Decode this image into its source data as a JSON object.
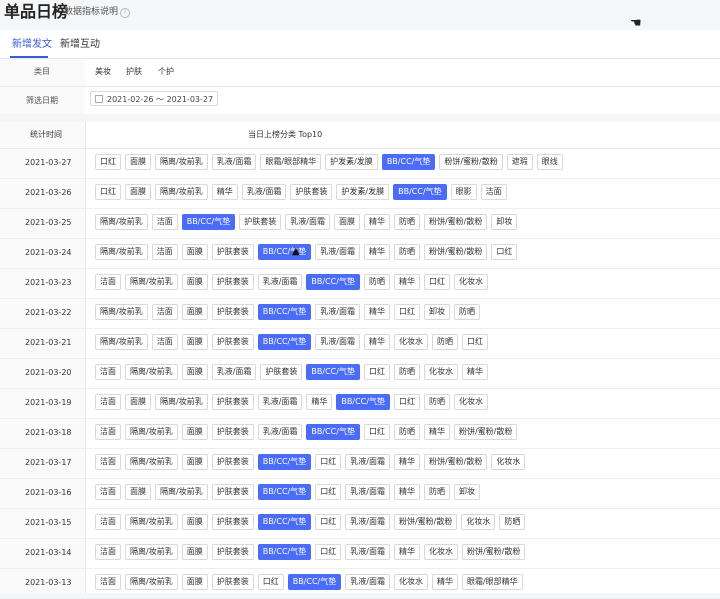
{
  "header": {
    "title": "单品日榜",
    "data_desc": "数据指标说明",
    "help_icon": "question-circle-icon",
    "cursor_icon": "hand-cursor-icon"
  },
  "tabs": [
    {
      "label": "新增发文",
      "active": true
    },
    {
      "label": "新增互动",
      "active": false
    }
  ],
  "filters": {
    "category_label": "类目",
    "categories": [
      "美妆",
      "护肤",
      "个护"
    ],
    "date_label": "筛选日期",
    "date_start": "2021-02-26",
    "date_sep": "～",
    "date_end": "2021-03-27",
    "calendar_icon": "calendar-icon"
  },
  "table": {
    "col_time": "统计时间",
    "col_top": "当日上榜分类 Top10",
    "highlight_color": "#4a6cf7",
    "highlight_tag": "BB/CC/气垫",
    "rows": [
      {
        "date": "2021-03-27",
        "tags": [
          "口红",
          "面膜",
          "隔离/妆前乳",
          "乳液/面霜",
          "眼霜/眼部精华",
          "护发素/发膜",
          "BB/CC/气垫",
          "粉饼/蜜粉/散粉",
          "遮瑕",
          "眼线"
        ]
      },
      {
        "date": "2021-03-26",
        "tags": [
          "口红",
          "面膜",
          "隔离/妆前乳",
          "精华",
          "乳液/面霜",
          "护肤套装",
          "护发素/发膜",
          "BB/CC/气垫",
          "眼影",
          "洁面"
        ]
      },
      {
        "date": "2021-03-25",
        "tags": [
          "隔离/妆前乳",
          "洁面",
          "BB/CC/气垫",
          "护肤套装",
          "乳液/面霜",
          "面膜",
          "精华",
          "防晒",
          "粉饼/蜜粉/散粉",
          "卸妆"
        ]
      },
      {
        "date": "2021-03-24",
        "tags": [
          "隔离/妆前乳",
          "洁面",
          "面膜",
          "护肤套装",
          "BB/CC/气垫",
          "乳液/面霜",
          "精华",
          "防晒",
          "粉饼/蜜粉/散粉",
          "口红"
        ]
      },
      {
        "date": "2021-03-23",
        "tags": [
          "洁面",
          "隔离/妆前乳",
          "面膜",
          "护肤套装",
          "乳液/面霜",
          "BB/CC/气垫",
          "防晒",
          "精华",
          "口红",
          "化妆水"
        ]
      },
      {
        "date": "2021-03-22",
        "tags": [
          "隔离/妆前乳",
          "洁面",
          "面膜",
          "护肤套装",
          "BB/CC/气垫",
          "乳液/面霜",
          "精华",
          "口红",
          "卸妆",
          "防晒"
        ]
      },
      {
        "date": "2021-03-21",
        "tags": [
          "隔离/妆前乳",
          "洁面",
          "面膜",
          "护肤套装",
          "BB/CC/气垫",
          "乳液/面霜",
          "精华",
          "化妆水",
          "防晒",
          "口红"
        ]
      },
      {
        "date": "2021-03-20",
        "tags": [
          "洁面",
          "隔离/妆前乳",
          "面膜",
          "乳液/面霜",
          "护肤套装",
          "BB/CC/气垫",
          "口红",
          "防晒",
          "化妆水",
          "精华"
        ]
      },
      {
        "date": "2021-03-19",
        "tags": [
          "洁面",
          "面膜",
          "隔离/妆前乳",
          "护肤套装",
          "乳液/面霜",
          "精华",
          "BB/CC/气垫",
          "口红",
          "防晒",
          "化妆水"
        ]
      },
      {
        "date": "2021-03-18",
        "tags": [
          "洁面",
          "隔离/妆前乳",
          "面膜",
          "护肤套装",
          "乳液/面霜",
          "BB/CC/气垫",
          "口红",
          "防晒",
          "精华",
          "粉饼/蜜粉/散粉"
        ]
      },
      {
        "date": "2021-03-17",
        "tags": [
          "洁面",
          "隔离/妆前乳",
          "面膜",
          "护肤套装",
          "BB/CC/气垫",
          "口红",
          "乳液/面霜",
          "精华",
          "粉饼/蜜粉/散粉",
          "化妆水"
        ]
      },
      {
        "date": "2021-03-16",
        "tags": [
          "洁面",
          "面膜",
          "隔离/妆前乳",
          "护肤套装",
          "BB/CC/气垫",
          "口红",
          "乳液/面霜",
          "精华",
          "防晒",
          "卸妆"
        ]
      },
      {
        "date": "2021-03-15",
        "tags": [
          "洁面",
          "隔离/妆前乳",
          "面膜",
          "护肤套装",
          "BB/CC/气垫",
          "口红",
          "乳液/面霜",
          "粉饼/蜜粉/散粉",
          "化妆水",
          "防晒"
        ]
      },
      {
        "date": "2021-03-14",
        "tags": [
          "洁面",
          "隔离/妆前乳",
          "面膜",
          "护肤套装",
          "BB/CC/气垫",
          "口红",
          "乳液/面霜",
          "精华",
          "化妆水",
          "粉饼/蜜粉/散粉"
        ]
      },
      {
        "date": "2021-03-13",
        "tags": [
          "洁面",
          "隔离/妆前乳",
          "面膜",
          "护肤套装",
          "口红",
          "BB/CC/气垫",
          "乳液/面霜",
          "化妆水",
          "精华",
          "眼霜/眼部精华"
        ]
      }
    ]
  }
}
